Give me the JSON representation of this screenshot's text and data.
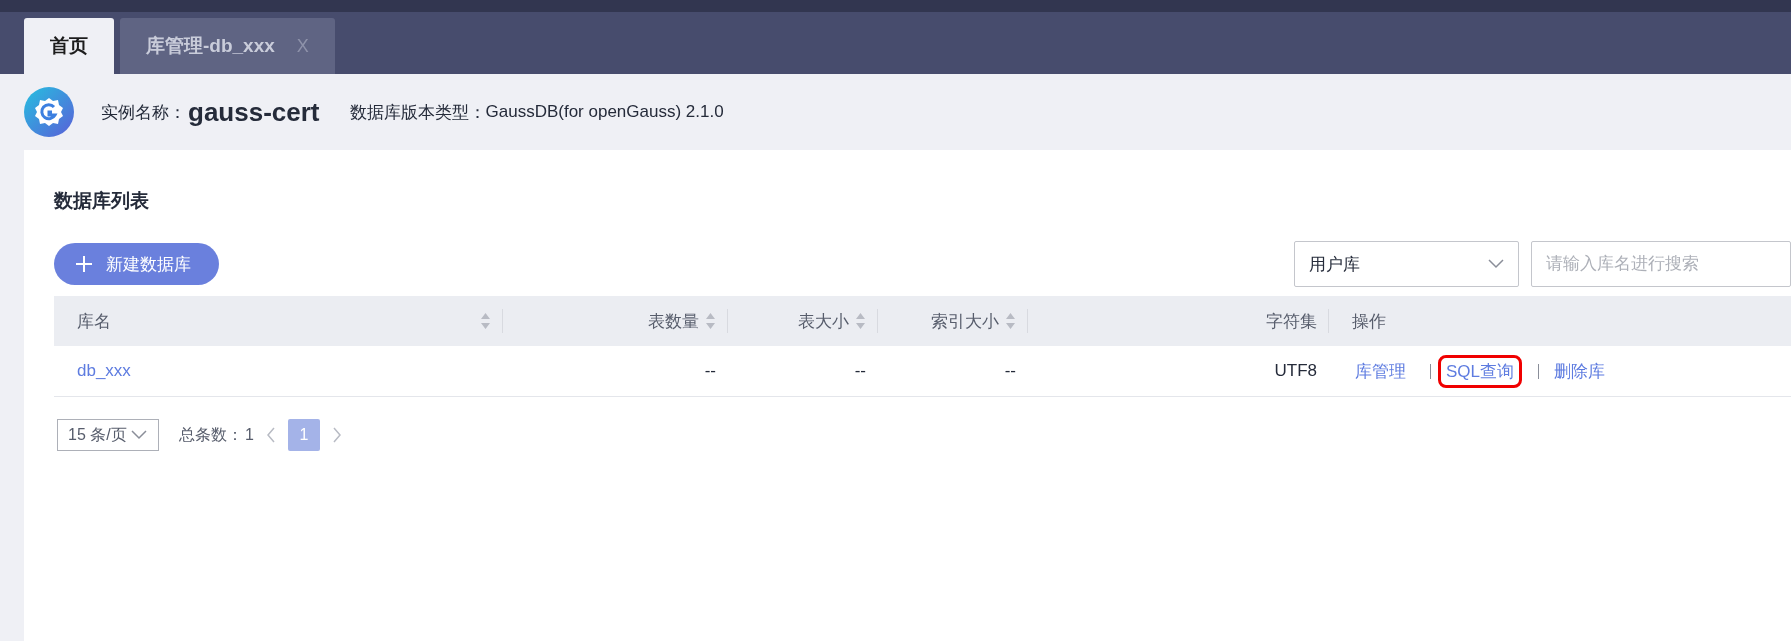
{
  "tabs": [
    {
      "label": "首页",
      "selected": true,
      "closable": false
    },
    {
      "label": "库管理-db_xxx",
      "selected": false,
      "closable": true,
      "close_glyph": "X"
    }
  ],
  "instance": {
    "name_label": "实例名称：",
    "name": "gauss-cert",
    "version_label": "数据库版本类型：",
    "version": "GaussDB(for openGauss) 2.1.0"
  },
  "panel": {
    "title": "数据库列表",
    "create_button": "新建数据库",
    "filter_select": {
      "value": "用户库"
    },
    "search": {
      "placeholder": "请输入库名进行搜索"
    }
  },
  "table": {
    "columns": [
      {
        "label": "库名",
        "sortable": true
      },
      {
        "label": "表数量",
        "sortable": true
      },
      {
        "label": "表大小",
        "sortable": true
      },
      {
        "label": "索引大小",
        "sortable": true
      },
      {
        "label": "字符集",
        "sortable": false
      },
      {
        "label": "操作",
        "sortable": false
      }
    ],
    "rows": [
      {
        "name": "db_xxx",
        "table_count": "--",
        "table_size": "--",
        "index_size": "--",
        "charset": "UTF8",
        "actions": [
          {
            "label": "库管理",
            "highlighted": false
          },
          {
            "label": "SQL查询",
            "highlighted": true
          },
          {
            "label": "删除库",
            "highlighted": false
          }
        ]
      }
    ]
  },
  "pagination": {
    "page_size": "15 条/页",
    "total_label": "总条数：",
    "total": "1",
    "pages": [
      {
        "label": "1",
        "selected": true
      }
    ]
  }
}
